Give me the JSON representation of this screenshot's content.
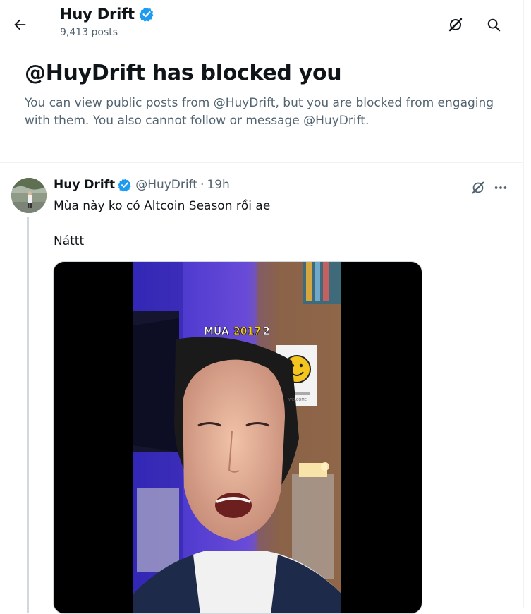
{
  "header": {
    "name": "Huy Drift",
    "posts_count": "9,413 posts"
  },
  "blocked": {
    "heading": "@HuyDrift has blocked you",
    "description": "You can view public posts from @HuyDrift, but you are blocked from engaging with them. You also cannot follow or message @HuyDrift."
  },
  "tweet": {
    "author_name": "Huy Drift",
    "handle": "@HuyDrift",
    "separator": "·",
    "time": "19h",
    "line1": "Mùa này ko có Altcoin Season rồi ae",
    "line2": "Náttt",
    "video_caption_prefix": "MÙA",
    "video_caption_year": "2017",
    "video_caption_suffix": "2",
    "poster_text": "WELCOME"
  },
  "icons": {
    "back": "arrow-left-icon",
    "grok": "grok-icon",
    "search": "search-icon",
    "verified": "verified-badge-icon",
    "more": "more-horizontal-icon"
  },
  "colors": {
    "verified_blue": "#1d9bf0",
    "text_primary": "#0f1419",
    "text_secondary": "#536471",
    "caption_yellow": "#f5d300"
  }
}
